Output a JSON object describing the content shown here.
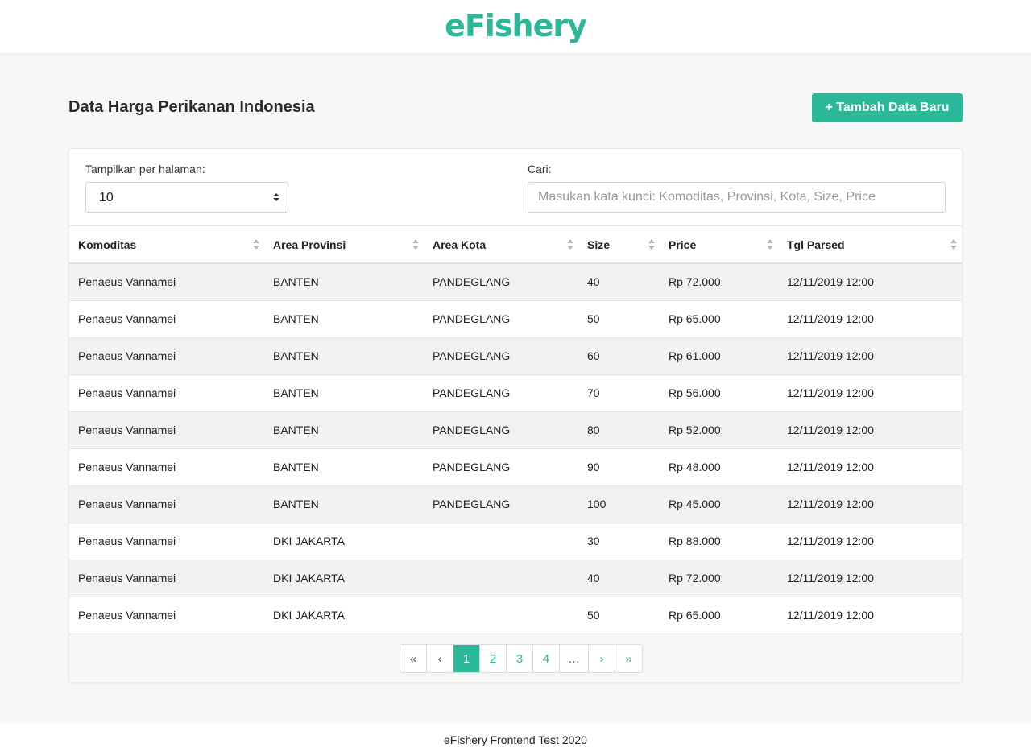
{
  "header": {
    "logo_text": "eFishery"
  },
  "page": {
    "title": "Data Harga Perikanan Indonesia",
    "add_button_label": "+ Tambah Data Baru"
  },
  "controls": {
    "per_page_label": "Tampilkan per halaman:",
    "per_page_value": "10",
    "search_label": "Cari:",
    "search_placeholder": "Masukan kata kunci: Komoditas, Provinsi, Kota, Size, Price",
    "search_value": ""
  },
  "table": {
    "columns": [
      "Komoditas",
      "Area Provinsi",
      "Area Kota",
      "Size",
      "Price",
      "Tgl Parsed"
    ],
    "rows": [
      [
        "Penaeus Vannamei",
        "BANTEN",
        "PANDEGLANG",
        "40",
        "Rp 72.000",
        "12/11/2019 12:00"
      ],
      [
        "Penaeus Vannamei",
        "BANTEN",
        "PANDEGLANG",
        "50",
        "Rp 65.000",
        "12/11/2019 12:00"
      ],
      [
        "Penaeus Vannamei",
        "BANTEN",
        "PANDEGLANG",
        "60",
        "Rp 61.000",
        "12/11/2019 12:00"
      ],
      [
        "Penaeus Vannamei",
        "BANTEN",
        "PANDEGLANG",
        "70",
        "Rp 56.000",
        "12/11/2019 12:00"
      ],
      [
        "Penaeus Vannamei",
        "BANTEN",
        "PANDEGLANG",
        "80",
        "Rp 52.000",
        "12/11/2019 12:00"
      ],
      [
        "Penaeus Vannamei",
        "BANTEN",
        "PANDEGLANG",
        "90",
        "Rp 48.000",
        "12/11/2019 12:00"
      ],
      [
        "Penaeus Vannamei",
        "BANTEN",
        "PANDEGLANG",
        "100",
        "Rp 45.000",
        "12/11/2019 12:00"
      ],
      [
        "Penaeus Vannamei",
        "DKI JAKARTA",
        "",
        "30",
        "Rp 88.000",
        "12/11/2019 12:00"
      ],
      [
        "Penaeus Vannamei",
        "DKI JAKARTA",
        "",
        "40",
        "Rp 72.000",
        "12/11/2019 12:00"
      ],
      [
        "Penaeus Vannamei",
        "DKI JAKARTA",
        "",
        "50",
        "Rp 65.000",
        "12/11/2019 12:00"
      ]
    ]
  },
  "pagination": {
    "first": "«",
    "prev": "‹",
    "pages": [
      "1",
      "2",
      "3",
      "4"
    ],
    "active_page": "1",
    "ellipsis": "…",
    "next": "›",
    "last": "»"
  },
  "footer": {
    "text": "eFishery Frontend Test 2020"
  },
  "colors": {
    "brand": "#2bb899",
    "page_bg": "#f7f7f7",
    "stripe": "#f2f2f2"
  }
}
